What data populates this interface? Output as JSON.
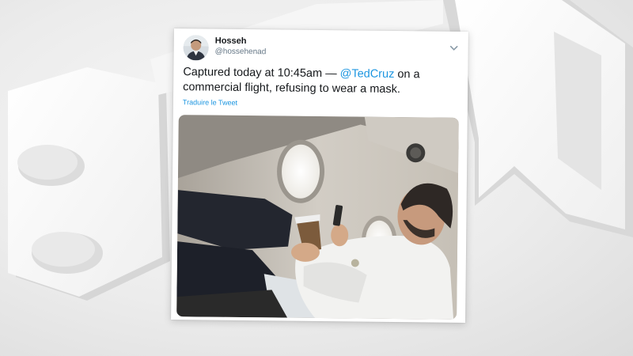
{
  "tweet": {
    "author_name": "Hosseh",
    "author_handle": "@hossehenad",
    "text_before": "Captured today at 10:45am — ",
    "mention": "@TedCruz",
    "text_after": " on a commercial flight, refusing to wear a mask.",
    "translate_label": "Traduire le Tweet"
  },
  "icons": {
    "menu": "chevron-down-icon",
    "avatar": "avatar"
  },
  "colors": {
    "link": "#1b95e0",
    "text": "#14171a",
    "muted": "#657786",
    "card": "#ffffff"
  }
}
